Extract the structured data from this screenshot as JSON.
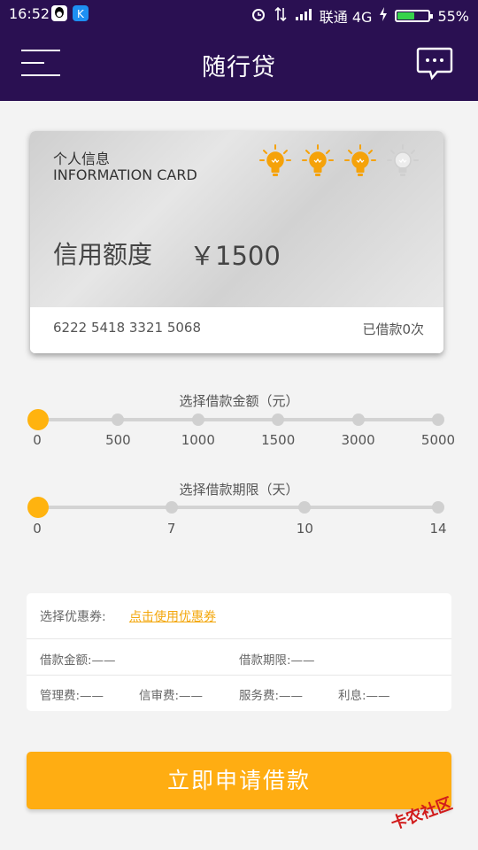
{
  "status_bar": {
    "time": "16:52",
    "carrier": "联通 4G",
    "battery": "55%",
    "battery_level": 0.55
  },
  "app_bar": {
    "title": "随行贷"
  },
  "card": {
    "title_cn": "个人信息",
    "title_en": "INFORMATION CARD",
    "rating": {
      "lit": 3,
      "total": 4
    },
    "credit_label": "信用额度",
    "credit_amount": "￥1500",
    "card_number": "6222 5418 3321 5068",
    "borrow_count": "已借款0次"
  },
  "amount_slider": {
    "title": "选择借款金额（元）",
    "ticks": [
      "0",
      "500",
      "1000",
      "1500",
      "3000",
      "5000"
    ],
    "selected_index": 0
  },
  "term_slider": {
    "title": "选择借款期限（天）",
    "ticks": [
      "0",
      "7",
      "10",
      "14"
    ],
    "selected_index": 0
  },
  "details": {
    "coupon_label": "选择优惠券:",
    "coupon_link": "点击使用优惠券",
    "loan_amount": "借款金额:——",
    "loan_term": "借款期限:——",
    "management_fee": "管理费:——",
    "review_fee": "信审费:——",
    "service_fee": "服务费:——",
    "interest": "利息:——"
  },
  "apply_button": {
    "label": "立即申请借款"
  },
  "watermark": {
    "text": "卡农社区"
  },
  "colors": {
    "header": "#2a1052",
    "accent": "#ffad12",
    "bulb_on": "#f5a20a",
    "bulb_off": "#cfcfcf"
  }
}
